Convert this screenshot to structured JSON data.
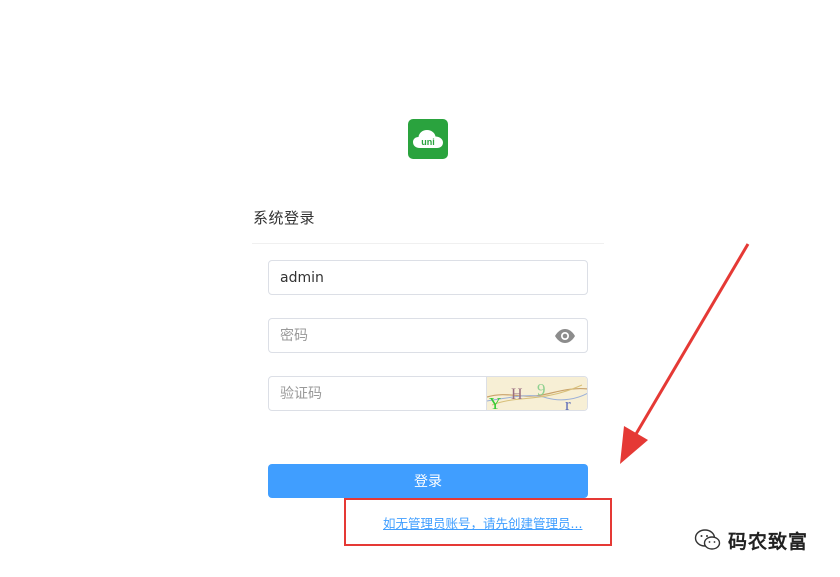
{
  "logo": {
    "text": "uni",
    "color": "#2aa33e"
  },
  "form": {
    "title": "系统登录",
    "username": {
      "value": "admin",
      "placeholder": ""
    },
    "password": {
      "value": "",
      "placeholder": "密码"
    },
    "captcha": {
      "value": "",
      "placeholder": "验证码",
      "image_chars": [
        "Y",
        "H",
        "9",
        "r"
      ]
    },
    "login_label": "登录",
    "create_admin_link": "如无管理员账号，请先创建管理员..."
  },
  "annotation": {
    "color": "#e53935"
  },
  "watermark": {
    "text": "码农致富",
    "icon": "wechat-icon"
  },
  "colors": {
    "primary": "#409eff",
    "border": "#dcdfe6"
  }
}
